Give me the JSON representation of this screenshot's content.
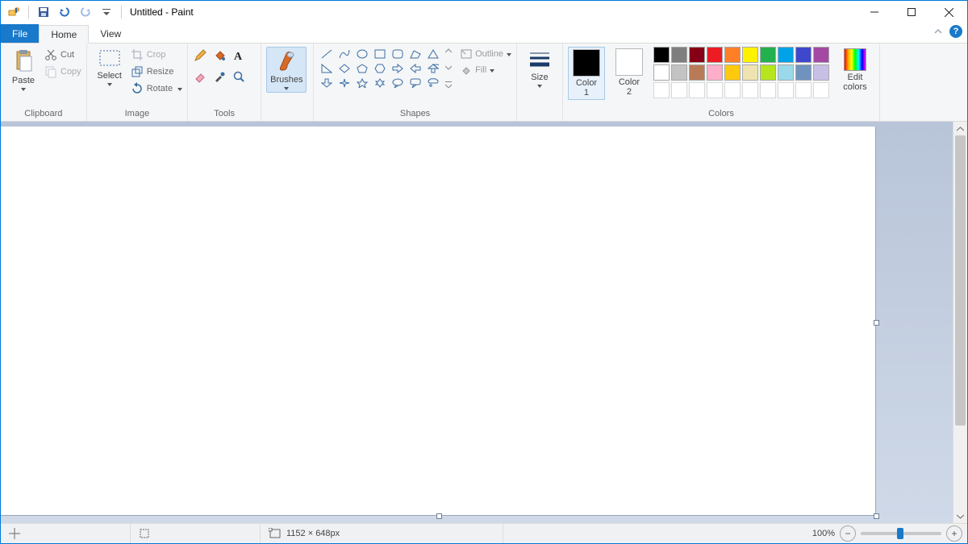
{
  "title": "Untitled - Paint",
  "tabs": {
    "file": "File",
    "home": "Home",
    "view": "View"
  },
  "groups": {
    "clipboard": {
      "label": "Clipboard",
      "paste": "Paste",
      "cut": "Cut",
      "copy": "Copy"
    },
    "image": {
      "label": "Image",
      "select": "Select",
      "crop": "Crop",
      "resize": "Resize",
      "rotate": "Rotate"
    },
    "tools": {
      "label": "Tools"
    },
    "brushes": {
      "label": "Brushes"
    },
    "shapes": {
      "label": "Shapes",
      "outline": "Outline",
      "fill": "Fill"
    },
    "size": {
      "label": "Size"
    },
    "colors": {
      "label": "Colors",
      "c1": "Color\n1",
      "c2": "Color\n2",
      "edit": "Edit\ncolors"
    }
  },
  "palette_row1": [
    "#000000",
    "#7f7f7f",
    "#880015",
    "#ed1c24",
    "#ff7f27",
    "#fff200",
    "#22b14c",
    "#00a2e8",
    "#3f48cc",
    "#a349a4"
  ],
  "palette_row2": [
    "#ffffff",
    "#c3c3c3",
    "#b97a57",
    "#ffaec9",
    "#ffc90e",
    "#efe4b0",
    "#b5e61d",
    "#99d9ea",
    "#7092be",
    "#c8bfe7"
  ],
  "status": {
    "cursor": "",
    "selection": "",
    "size": "1152 × 648px",
    "zoom": "100%"
  },
  "colors_selected": {
    "c1": "#000000",
    "c2": "#ffffff"
  }
}
